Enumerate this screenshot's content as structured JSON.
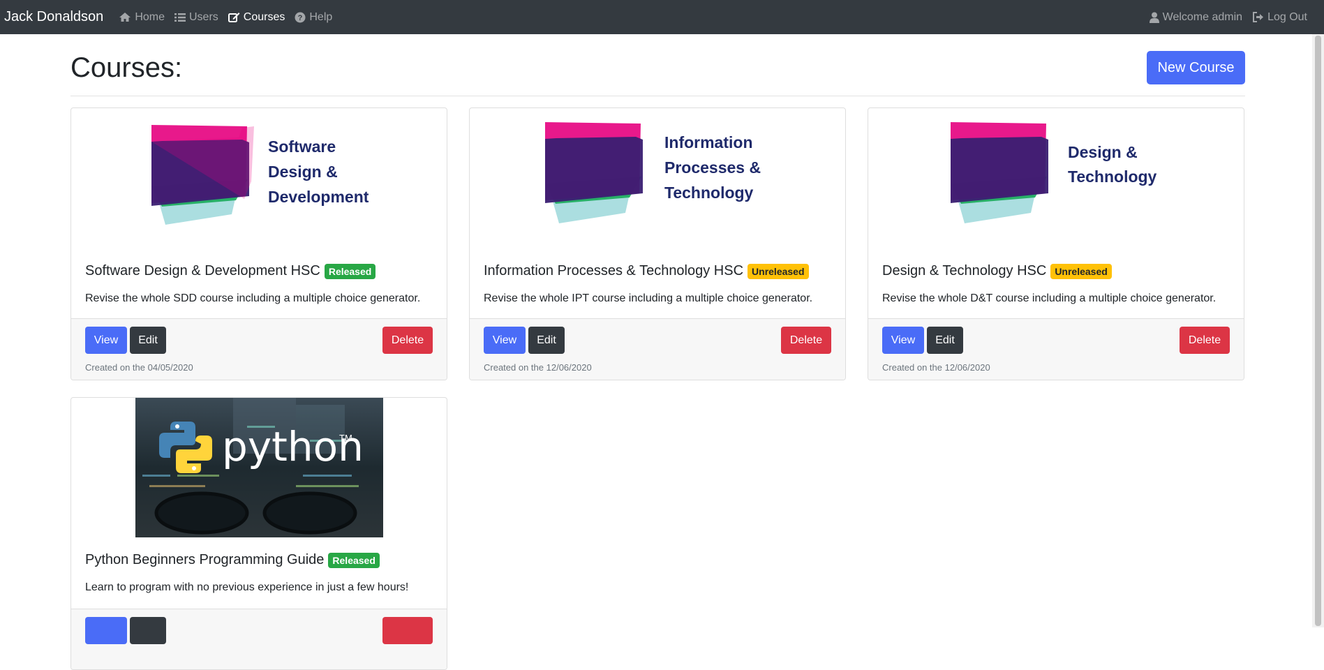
{
  "nav": {
    "brand": "Jack Donaldson",
    "items": [
      {
        "label": "Home",
        "icon": "home-icon"
      },
      {
        "label": "Users",
        "icon": "list-icon"
      },
      {
        "label": "Courses",
        "icon": "edit-icon",
        "active": true
      },
      {
        "label": "Help",
        "icon": "question-circle-icon"
      }
    ],
    "welcome": "Welcome admin",
    "logout": "Log Out"
  },
  "page": {
    "title": "Courses:",
    "new_course_label": "New Course"
  },
  "courses": [
    {
      "title": "Software Design & Development HSC",
      "status": "Released",
      "description": "Revise the whole SDD course including a multiple choice generator.",
      "created": "Created on the 04/05/2020",
      "image_lines": [
        "Software",
        "Design &",
        "Development"
      ],
      "view": "View",
      "edit": "Edit",
      "delete": "Delete"
    },
    {
      "title": "Information Processes & Technology HSC",
      "status": "Unreleased",
      "description": "Revise the whole IPT course including a multiple choice generator.",
      "created": "Created on the 12/06/2020",
      "image_lines": [
        "Information",
        "Processes &",
        "Technology"
      ],
      "view": "View",
      "edit": "Edit",
      "delete": "Delete"
    },
    {
      "title": "Design & Technology HSC",
      "status": "Unreleased",
      "description": "Revise the whole D&T course including a multiple choice generator.",
      "created": "Created on the 12/06/2020",
      "image_lines": [
        "Design &",
        "Technology"
      ],
      "view": "View",
      "edit": "Edit",
      "delete": "Delete"
    },
    {
      "title": "Python Beginners Programming Guide",
      "status": "Released",
      "description": "Learn to program with no previous experience in just a few hours!",
      "image_text": "python",
      "image_tm": "TM"
    }
  ],
  "colors": {
    "navbar": "#343a40",
    "primary": "#4a6cf7",
    "dark": "#343a40",
    "danger": "#dc3545",
    "released": "#28a745",
    "unreleased": "#ffc107",
    "logo_pink": "#e6007e",
    "logo_purple": "#3a1f72",
    "logo_green": "#1aab5a",
    "logo_teal": "#8fd3d6",
    "logo_text": "#1f2a6b"
  }
}
